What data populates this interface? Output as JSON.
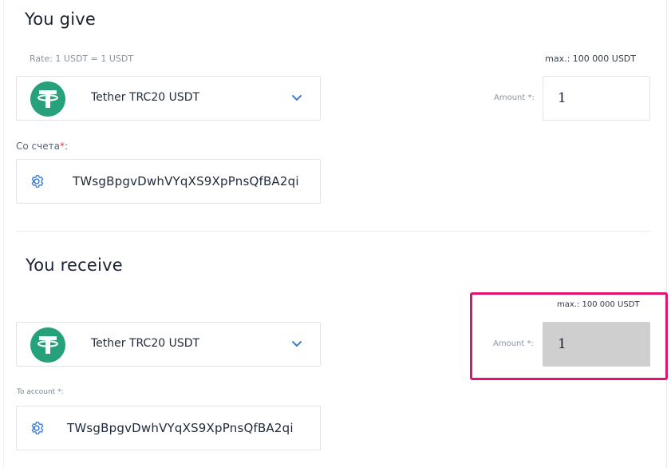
{
  "give": {
    "title": "You give",
    "rate": "Rate: 1 USDT = 1 USDT",
    "max": "max.: 100 000 USDT",
    "currency": "Tether TRC20 USDT",
    "amount_label": "Amount *:",
    "amount_value": "1",
    "account_label": "Со счета",
    "account_required": "*",
    "account_colon": ":",
    "account_value": "TWsgBpgvDwhVYqXS9XpPnsQfBA2qi"
  },
  "receive": {
    "title": "You receive",
    "max": "max.: 100 000 USDT",
    "currency": "Tether TRC20 USDT",
    "amount_label": "Amount *:",
    "amount_value": "1",
    "account_label": "To account *:",
    "account_value": "TWsgBpgvDwhVYqXS9XpPnsQfBA2qi"
  },
  "colors": {
    "tether_green": "#26a17b",
    "accent_blue": "#3b7fd4",
    "highlight": "#e0136f",
    "disabled_input": "#cfcfcf"
  },
  "icons": {
    "currency_logo": "tether-logo-icon",
    "dropdown": "chevron-down-icon",
    "settings": "gear-icon"
  }
}
